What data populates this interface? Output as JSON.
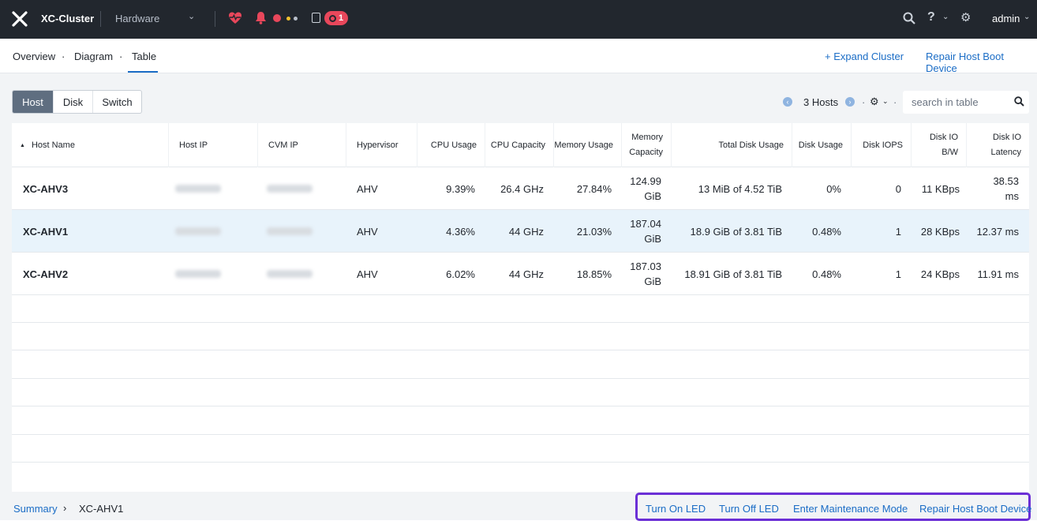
{
  "topbar": {
    "cluster_name": "XC-Cluster",
    "section": "Hardware",
    "task_count": "1",
    "user": "admin",
    "colors": {
      "bg": "#22272e",
      "alert": "#e8475b",
      "warning": "#f3c12e"
    }
  },
  "subnav": {
    "tabs": [
      "Overview",
      "Diagram",
      "Table"
    ],
    "active_tab": "Table",
    "expand_cluster": "+ Expand Cluster",
    "repair_boot": "Repair Host Boot Device"
  },
  "entity_toggle": {
    "options": [
      "Host",
      "Disk",
      "Switch"
    ],
    "active": "Host"
  },
  "table_controls": {
    "count_label": "3 Hosts",
    "search_placeholder": "search in table"
  },
  "table": {
    "headers": {
      "host_name": "Host Name",
      "host_ip": "Host IP",
      "cvm_ip": "CVM IP",
      "hypervisor": "Hypervisor",
      "cpu_usage": "CPU Usage",
      "cpu_capacity": "CPU Capacity",
      "memory_usage": "Memory Usage",
      "memory_capacity": "Memory Capacity",
      "total_disk_usage": "Total Disk Usage",
      "disk_usage": "Disk Usage",
      "disk_iops": "Disk IOPS",
      "disk_io_bw": "Disk IO B/W",
      "disk_io_latency": "Disk IO Latency"
    },
    "sort_column": "Host Name",
    "rows": [
      {
        "name": "XC-AHV3",
        "hypervisor": "AHV",
        "cpu_usage": "9.39%",
        "cpu_capacity": "26.4 GHz",
        "memory_usage": "27.84%",
        "memory_capacity": "124.99 GiB",
        "total_disk_usage": "13 MiB of 4.52 TiB",
        "disk_usage": "0%",
        "disk_iops": "0",
        "disk_io_bw": "11 KBps",
        "disk_io_latency": "38.53 ms",
        "selected": false
      },
      {
        "name": "XC-AHV1",
        "hypervisor": "AHV",
        "cpu_usage": "4.36%",
        "cpu_capacity": "44 GHz",
        "memory_usage": "21.03%",
        "memory_capacity": "187.04 GiB",
        "total_disk_usage": "18.9 GiB of 3.81 TiB",
        "disk_usage": "0.48%",
        "disk_iops": "1",
        "disk_io_bw": "28 KBps",
        "disk_io_latency": "12.37 ms",
        "selected": true
      },
      {
        "name": "XC-AHV2",
        "hypervisor": "AHV",
        "cpu_usage": "6.02%",
        "cpu_capacity": "44 GHz",
        "memory_usage": "18.85%",
        "memory_capacity": "187.03 GiB",
        "total_disk_usage": "18.91 GiB of 3.81 TiB",
        "disk_usage": "0.48%",
        "disk_iops": "1",
        "disk_io_bw": "24 KBps",
        "disk_io_latency": "11.91 ms",
        "selected": false
      }
    ]
  },
  "footer": {
    "breadcrumb_root": "Summary",
    "breadcrumb_current": "XC-AHV1",
    "actions": [
      "Turn On LED",
      "Turn Off LED",
      "Enter Maintenance Mode",
      "Repair Host Boot Device"
    ],
    "highlight_color": "#6b2fd6",
    "link_color": "#1b6dc6"
  }
}
